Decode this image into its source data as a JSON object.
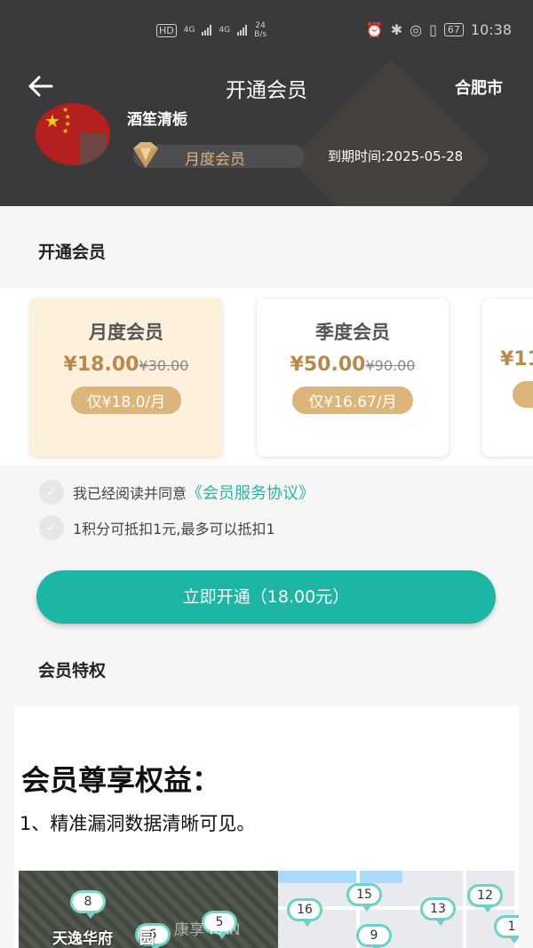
{
  "status_bar": {
    "network_tag": "HD",
    "signal_a": "4G",
    "signal_b": "4G",
    "speed_value": "24",
    "speed_unit": "B/s",
    "battery": "67",
    "time": "10:38"
  },
  "nav": {
    "title": "开通会员",
    "city": "合肥市"
  },
  "profile": {
    "username": "酒笙清栀",
    "membership_badge": "月度会员",
    "expiry": "到期时间:2025-05-28"
  },
  "plans_section": {
    "title": "开通会员",
    "plans": [
      {
        "name": "月度会员",
        "price": "¥18.00",
        "original": "¥30.00",
        "per": "仅¥18.0/月",
        "selected": true
      },
      {
        "name": "季度会员",
        "price": "¥50.00",
        "original": "¥90.00",
        "per": "仅¥16.67/月",
        "selected": false
      },
      {
        "name": "",
        "price": "¥11",
        "original": "",
        "per": "",
        "selected": false
      }
    ]
  },
  "agreement": {
    "prefix": "我已经阅读并同意",
    "link": "《会员服务协议》"
  },
  "points_note": "1积分可抵扣1元,最多可以抵扣1",
  "open_button": "立即开通（18.00元）",
  "benefits": {
    "title": "会员特权",
    "heading": "会员尊享权益：",
    "item1": "1、精准漏洞数据清晰可见。"
  },
  "map": {
    "place_label": "天逸华府",
    "place_label_suffix": "园",
    "watermark": "康享 KAN",
    "pins": [
      "8",
      "5",
      "6",
      "15",
      "16",
      "13",
      "12",
      "9",
      "1"
    ]
  },
  "colors": {
    "header_bg": "#3a3a3c",
    "accent_teal": "#1db5a4",
    "gold": "#dcb57a",
    "active_plan_bg": "#fdf0dc"
  }
}
